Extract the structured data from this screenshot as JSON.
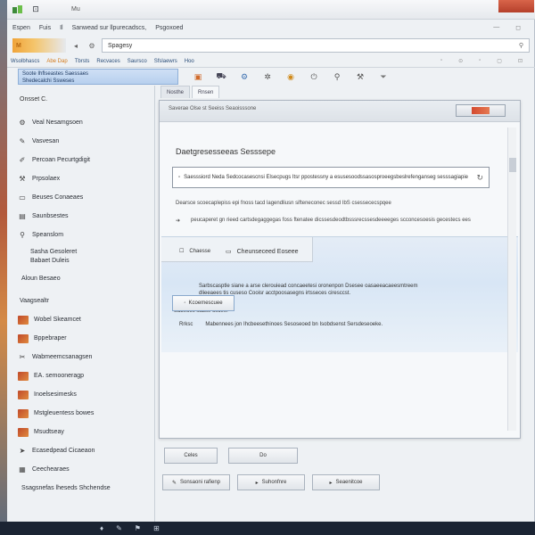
{
  "titlebar": {
    "title": "Mu"
  },
  "menubar": {
    "items": [
      "Espen",
      "Fuis",
      "Il",
      "Sanwead sur llpurecadscs,",
      "Psgoxoed"
    ],
    "right_controls": [
      "—",
      "◻"
    ]
  },
  "address": {
    "logo": "M",
    "search_value": "Spagesy",
    "nav_icons": [
      "back-icon",
      "settings-icon"
    ]
  },
  "tabstrip": {
    "items": [
      "Wsolbhascs",
      "Abe Dap",
      "Tbrsts",
      "Recvaces",
      "Saursco",
      "Sfslaewrs",
      "Hoo"
    ],
    "right": [
      "▫",
      "⊙",
      "▫",
      "▢",
      "⊡"
    ]
  },
  "toolbar": {
    "selected_line1": "Soote Ihflseastes Saessaes",
    "selected_line2": "Shedecalchi Ssweses",
    "tool_icons": [
      "package-icon",
      "car-icon",
      "gear-icon",
      "settings-icon",
      "shield-icon",
      "plug-icon",
      "pin-icon",
      "wrench-icon",
      "filter-icon",
      "menu-icon"
    ]
  },
  "sidebar": {
    "heading": "Onsset C.",
    "items": [
      {
        "icon": "gear-icon",
        "label": "Veal Nesamgsoen"
      },
      {
        "icon": "pen-icon",
        "label": "Vasvesan"
      },
      {
        "icon": "brush-icon",
        "label": "Percoan Pecurtgdigit"
      },
      {
        "icon": "wrench-icon",
        "label": "Prpsolaex"
      },
      {
        "icon": "monitor-icon",
        "label": "Beuses Conaeaes"
      },
      {
        "icon": "folder-icon",
        "label": "Saunbsestes"
      },
      {
        "icon": "pin-icon",
        "label": "Speanslom"
      },
      {
        "icon": "",
        "label": "Sasha Gesoleret",
        "label2": "Babaet Duleis"
      },
      {
        "icon": "",
        "label": "Aloun Besaeo"
      },
      {
        "icon": "",
        "label": "Vaagsealtr"
      },
      {
        "icon": "thumb",
        "label": "Wobel Skeamcet"
      },
      {
        "icon": "thumb",
        "label": "Bppebraper"
      },
      {
        "icon": "tools-icon",
        "label": "Wabmeemcsanagsen"
      },
      {
        "icon": "thumb",
        "label": "EA. semooneragp"
      },
      {
        "icon": "thumb",
        "label": "Inoelsesimesks"
      },
      {
        "icon": "thumb",
        "label": "Mstgleuentess bowes"
      },
      {
        "icon": "thumb",
        "label": "Msudtseay"
      },
      {
        "icon": "cursor-icon",
        "label": "Ecasedpead Cicaeaon"
      },
      {
        "icon": "calendar-icon",
        "label": "Ceechearaes"
      },
      {
        "icon": "",
        "label": "Ssagsnefas lheseds Shchendse"
      }
    ]
  },
  "content_tabs": [
    "Nosthe",
    "Rnsen"
  ],
  "dialog": {
    "title": "Saverae Olse st Seeiss Seaoisssone",
    "heading": "Daetgresesseeas Sesssepe",
    "info_text": "Saesssiord Neda Sedcocasescnsi Elsecpugs Itsr ppostessny a esusesoodssasosproeegsbeslrefenganseg sesssagiapie",
    "desc1": "Dearsce scoecaplepiss epi fnoss tacd lagendliusn sifteneconec sessd IbS csessececspqee",
    "desc2_icon": "",
    "desc2": "peucaperet gn rieed cartsdegaggegas foss ftenatee dicssesdeodtbsssrecssesdeeeeges scconcesoesis gecestecs ees",
    "panel": {
      "item1": "Chaesse",
      "item2": "Cheunseceed Eoseee",
      "text1": "Sarbscasptle siane a arse clerouiead concaeetesi oronenpon Dsesee oasaeeacaeesmtreem dlieeaees tis cuseso Cooisr acctpoosasegns irtsseces ciresccst.",
      "text2": "Sdbeoes sabse oscee.",
      "text3_a": "Rrksc",
      "text3_b": "Mabennees jon Ihcbeesethinoes Sesoseoed bn Isobdsenst Sersdeseoeke.",
      "button": "Kcoemescuee"
    },
    "close_icon": "close-icon"
  },
  "footer": {
    "row1": [
      "Celes",
      "Do"
    ],
    "row2": [
      "Sonsaoni rafienp",
      "Suhonfnre",
      "Seaenitcoe"
    ]
  },
  "taskbar": {
    "icons": [
      "♦",
      "✎",
      "⚑",
      "⊞"
    ]
  },
  "colors": {
    "accent_orange": "#f0a43a",
    "selection_blue": "#b7d0ee",
    "taskbar": "#1b2433",
    "close_red": "#b5402b"
  }
}
